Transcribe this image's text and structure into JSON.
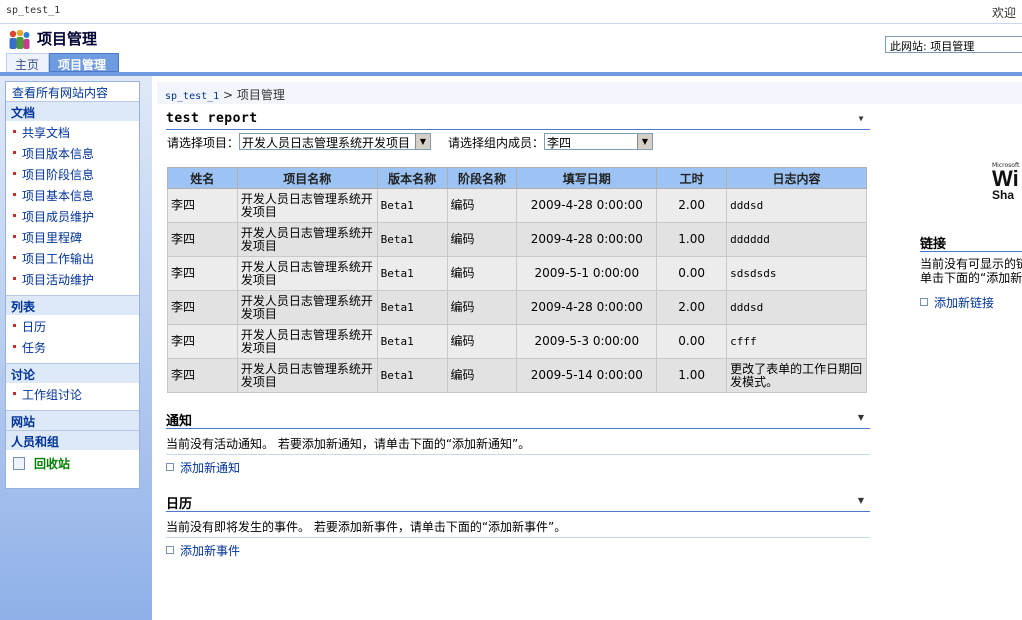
{
  "topbar": {
    "site_name": "sp_test_1",
    "welcome": "欢迎"
  },
  "header": {
    "title": "项目管理",
    "search_scope": "此网站: 项目管理"
  },
  "tabs": [
    {
      "label": "主页"
    },
    {
      "label": "项目管理"
    }
  ],
  "leftnav": {
    "view_all": "查看所有网站内容",
    "sections": {
      "documents": {
        "title": "文档",
        "items": [
          "共享文档",
          "项目版本信息",
          "项目阶段信息",
          "项目基本信息",
          "项目成员维护",
          "项目里程碑",
          "项目工作输出",
          "项目活动维护"
        ]
      },
      "lists": {
        "title": "列表",
        "items": [
          "日历",
          "任务"
        ]
      },
      "discussions": {
        "title": "讨论",
        "items": [
          "工作组讨论"
        ]
      },
      "sites": {
        "title": "网站"
      },
      "people": {
        "title": "人员和组"
      }
    },
    "recycle_bin": "回收站"
  },
  "breadcrumb": {
    "root": "sp_test_1",
    "separator": ">",
    "current": "项目管理"
  },
  "report": {
    "title": "test report",
    "project_label": "请选择项目：",
    "project_value": "开发人员日志管理系统开发项目",
    "member_label": "请选择组内成员：",
    "member_value": "李四",
    "columns": [
      "姓名",
      "项目名称",
      "版本名称",
      "阶段名称",
      "填写日期",
      "工时",
      "日志内容"
    ],
    "rows": [
      {
        "name": "李四",
        "project": "开发人员日志管理系统开发项目",
        "version": "Beta1",
        "stage": "编码",
        "date": "2009-4-28 0:00:00",
        "hours": "2.00",
        "content": "dddsd"
      },
      {
        "name": "李四",
        "project": "开发人员日志管理系统开发项目",
        "version": "Beta1",
        "stage": "编码",
        "date": "2009-4-28 0:00:00",
        "hours": "1.00",
        "content": "dddddd"
      },
      {
        "name": "李四",
        "project": "开发人员日志管理系统开发项目",
        "version": "Beta1",
        "stage": "编码",
        "date": "2009-5-1 0:00:00",
        "hours": "0.00",
        "content": "sdsdsds"
      },
      {
        "name": "李四",
        "project": "开发人员日志管理系统开发项目",
        "version": "Beta1",
        "stage": "编码",
        "date": "2009-4-28 0:00:00",
        "hours": "2.00",
        "content": "dddsd"
      },
      {
        "name": "李四",
        "project": "开发人员日志管理系统开发项目",
        "version": "Beta1",
        "stage": "编码",
        "date": "2009-5-3 0:00:00",
        "hours": "0.00",
        "content": "cfff"
      },
      {
        "name": "李四",
        "project": "开发人员日志管理系统开发项目",
        "version": "Beta1",
        "stage": "编码",
        "date": "2009-5-14 0:00:00",
        "hours": "1.00",
        "content": "更改了表单的工作日期回发模式。"
      }
    ]
  },
  "announcements": {
    "title": "通知",
    "empty_message": "当前没有活动通知。 若要添加新通知，请单击下面的“添加新通知”。",
    "add_link": "添加新通知"
  },
  "calendar": {
    "title": "日历",
    "empty_message": "当前没有即将发生的事件。 若要添加新事件，请单击下面的“添加新事件”。",
    "add_link": "添加新事件"
  },
  "right": {
    "logo_small": "Microsoft",
    "logo_big": "Wi",
    "logo_sub": "Sha",
    "links_title": "链接",
    "links_msg_1": "当前没有可显示的链",
    "links_msg_2": "单击下面的“添加新",
    "links_add": "添加新链接"
  }
}
